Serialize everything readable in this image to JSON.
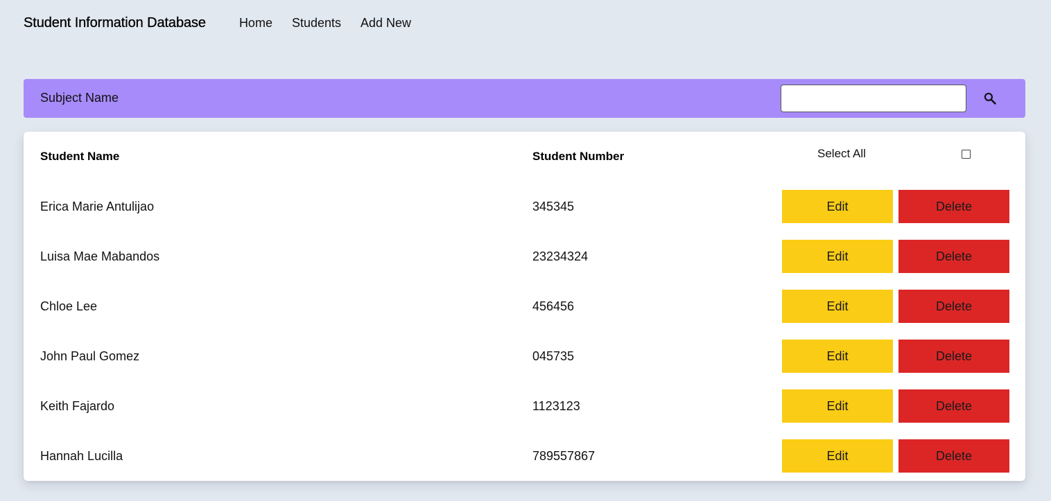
{
  "header": {
    "brand": "Student Information Database",
    "nav": [
      "Home",
      "Students",
      "Add New"
    ]
  },
  "subject": {
    "title": "Subject Name",
    "search_value": "",
    "search_placeholder": "",
    "search_icon": "search-icon"
  },
  "table": {
    "columns": [
      "Student Name",
      "Student Number"
    ],
    "select_all_label": "Select All",
    "select_all_checked": false,
    "edit_label": "Edit",
    "delete_label": "Delete",
    "rows": [
      {
        "name": "Erica Marie Antulijao",
        "number": "345345"
      },
      {
        "name": "Luisa Mae Mabandos",
        "number": "23234324"
      },
      {
        "name": "Chloe Lee",
        "number": "456456"
      },
      {
        "name": "John Paul Gomez",
        "number": "045735"
      },
      {
        "name": "Keith Fajardo",
        "number": "1123123"
      },
      {
        "name": "Hannah Lucilla",
        "number": "789557867"
      }
    ]
  },
  "colors": {
    "background": "#e2e8f0",
    "subject_bar": "#a78bfa",
    "edit": "#facc15",
    "delete": "#dc2626"
  }
}
